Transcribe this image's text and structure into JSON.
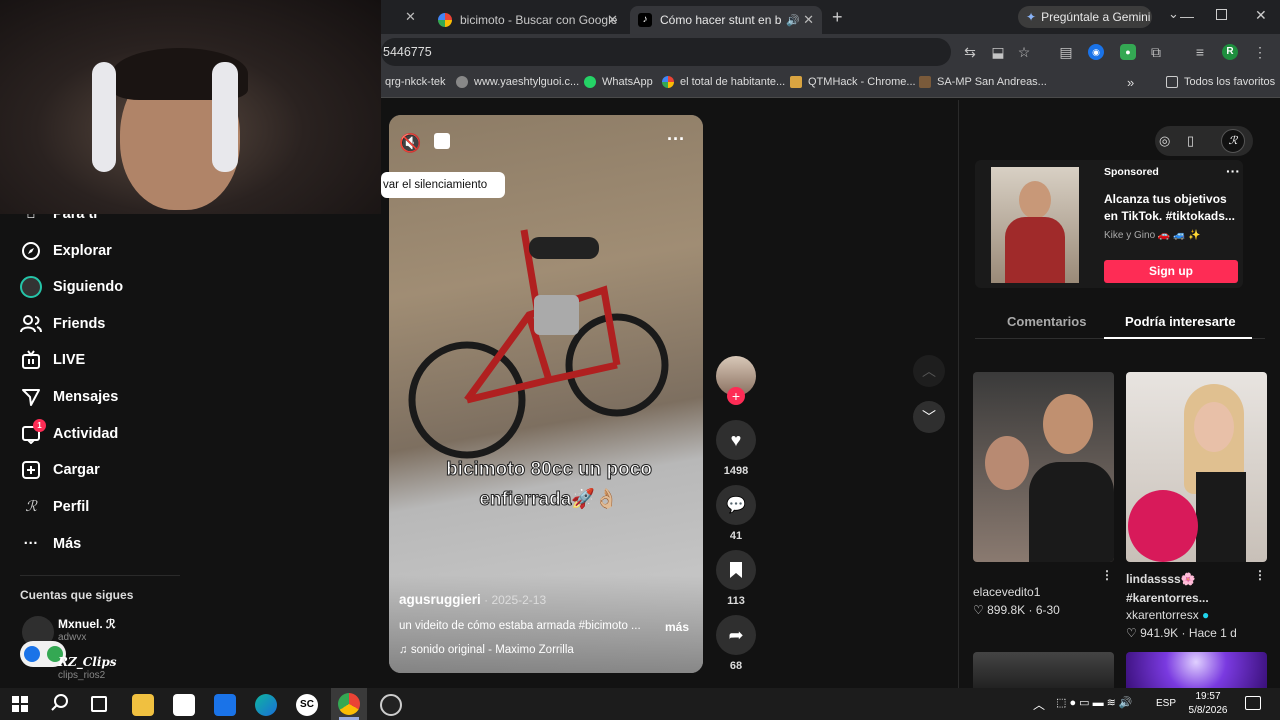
{
  "browser": {
    "tabs": [
      {
        "title": "bicimoto - Buscar con Google",
        "active": false
      },
      {
        "title": "Cómo hacer stunt en bicimo",
        "active": true
      }
    ],
    "gemini_label": "Pregúntale a Gemini",
    "url": "5446775",
    "bookmarks": [
      "qrg-nkck-tek",
      "www.yaeshtylguoi.c...",
      "WhatsApp",
      "el total de habitante...",
      "QTMHack - Chrome...",
      "SA-MP San Andreas..."
    ],
    "all_bookmarks": "Todos los favoritos",
    "profile_initial": "R"
  },
  "sidebar": {
    "items": [
      {
        "label": "Para ti"
      },
      {
        "label": "Explorar"
      },
      {
        "label": "Siguiendo"
      },
      {
        "label": "Friends"
      },
      {
        "label": "LIVE"
      },
      {
        "label": "Mensajes"
      },
      {
        "label": "Actividad",
        "badge": "1"
      },
      {
        "label": "Cargar"
      },
      {
        "label": "Perfil"
      },
      {
        "label": "Más"
      }
    ],
    "following_title": "Cuentas que sigues",
    "following": [
      {
        "name": "Mxnuel. ℛ",
        "handle": "adwvx"
      },
      {
        "name": "RZ_Clips",
        "handle": "clips_rios2"
      }
    ]
  },
  "video": {
    "tooltip": "var el silenciamiento",
    "overlay_text": [
      "bicimoto 80cc un poco",
      "enfierrada🚀👌🏼"
    ],
    "author": "agusruggieri",
    "date": "2025-2-13",
    "description": "un videito de cómo estaba armada #bicimoto ...",
    "more": "más",
    "sound": "sonido original - Maximo Zorrilla",
    "likes": "1498",
    "comments": "41",
    "saves": "113",
    "shares": "68"
  },
  "right": {
    "sponsored": "Sponsored",
    "ad_title": "Alcanza tus objetivos en TikTok. #tiktokads...",
    "ad_author": "Kike y Gino 🚗 🚙 ✨",
    "ad_cta": "Sign up",
    "tab_comments": "Comentarios",
    "tab_related": "Podría interesarte",
    "cards": [
      {
        "user": "elacevedito1",
        "caption": "",
        "likes": "899.8K",
        "when": "6-30"
      },
      {
        "user": "xkarentorresx",
        "caption": "lindassss🌸 #karentorres...",
        "likes": "941.9K",
        "when": "Hace 1 d"
      }
    ]
  },
  "taskbar": {
    "lang": "ESP",
    "time": "19:57",
    "date": "5/8/2026"
  }
}
